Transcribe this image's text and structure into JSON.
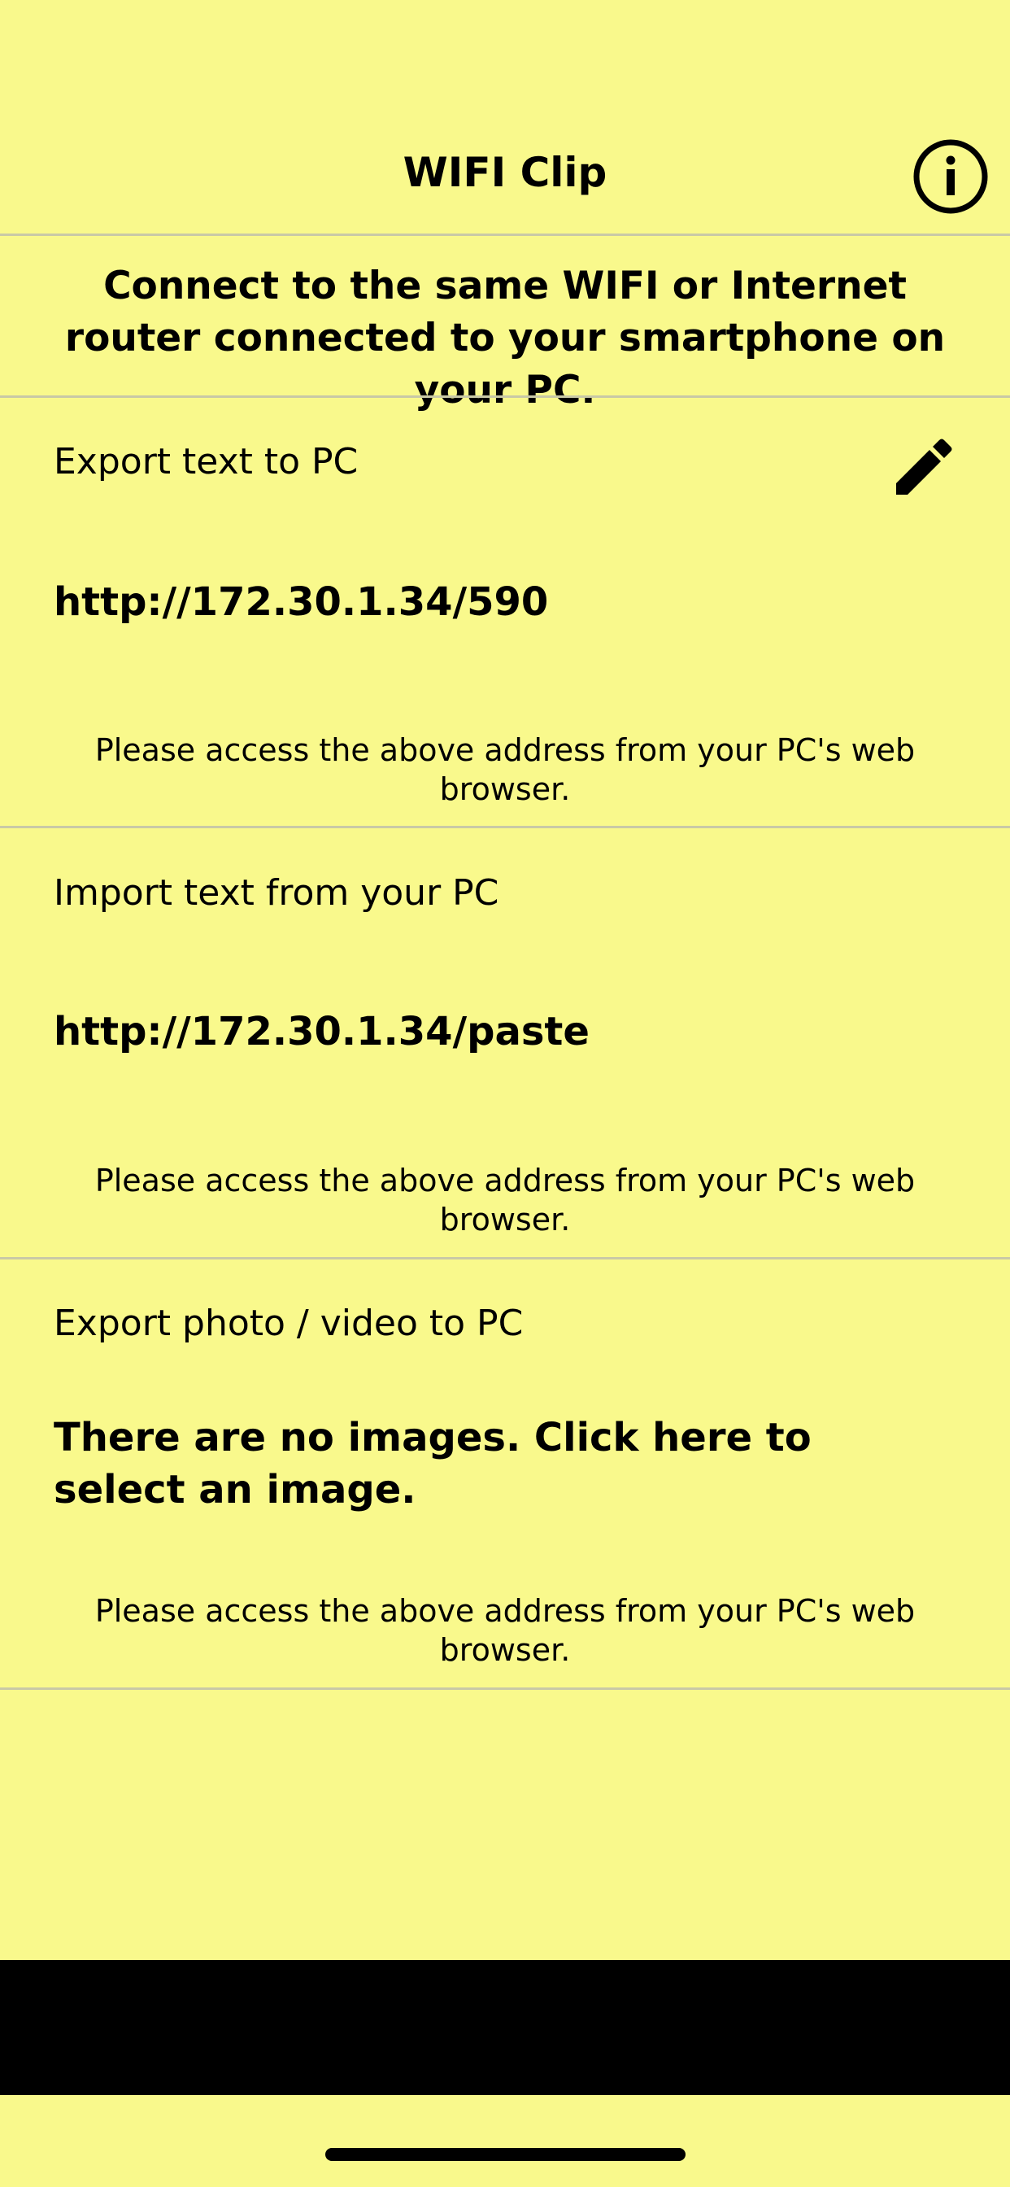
{
  "header": {
    "title": "WIFI Clip"
  },
  "banner": {
    "text": "Connect to the same WIFI or Internet router connected to your smartphone on your PC."
  },
  "sections": [
    {
      "label": "Export text to PC",
      "address": "http://172.30.1.34/590",
      "note": "Please access the above address from your PC's web browser."
    },
    {
      "label": "Import text from your PC",
      "address": "http://172.30.1.34/paste",
      "note": "Please access the above address from your PC's web browser."
    },
    {
      "label": "Export photo / video to PC",
      "address": "There are no images. Click here to select an image.",
      "note": "Please access the above address from your PC's web browser."
    }
  ],
  "icons": {
    "info": "info-circle-icon",
    "edit": "pencil-icon"
  },
  "colors": {
    "background": "#f9f98c",
    "text": "#000000",
    "divider": "#c9c9a6"
  }
}
